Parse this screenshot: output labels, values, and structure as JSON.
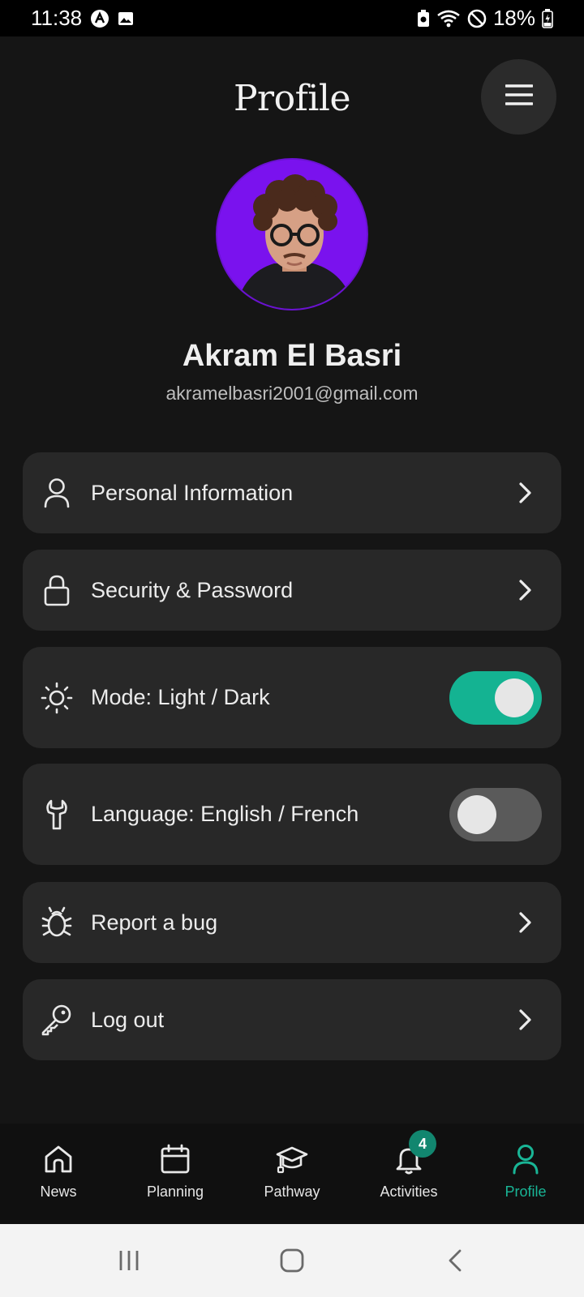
{
  "status_bar": {
    "time": "11:38",
    "battery": "18%",
    "icons": [
      "a-app-icon",
      "image-icon",
      "battery-saver-icon",
      "wifi-icon",
      "do-not-disturb-icon",
      "battery-charging-icon"
    ]
  },
  "header": {
    "title": "Profile",
    "menu_icon": "hamburger-icon"
  },
  "user": {
    "name": "Akram El Basri",
    "email": "akramelbasri2001@gmail.com"
  },
  "menu": {
    "items": [
      {
        "label": "Personal Information",
        "icon": "user-icon",
        "control": "chevron"
      },
      {
        "label": "Security & Password",
        "icon": "lock-icon",
        "control": "chevron"
      },
      {
        "label": "Mode: Light / Dark",
        "icon": "sun-icon",
        "control": "toggle",
        "toggle_on": true
      },
      {
        "label": "Language: English / French",
        "icon": "wrench-icon",
        "control": "toggle",
        "toggle_on": false
      },
      {
        "label": "Report a bug",
        "icon": "bug-icon",
        "control": "chevron"
      },
      {
        "label": "Log out",
        "icon": "key-icon",
        "control": "chevron"
      }
    ]
  },
  "bottom_nav": {
    "items": [
      {
        "label": "News",
        "icon": "home-icon"
      },
      {
        "label": "Planning",
        "icon": "calendar-icon"
      },
      {
        "label": "Pathway",
        "icon": "graduation-cap-icon"
      },
      {
        "label": "Activities",
        "icon": "bell-icon",
        "badge": "4"
      },
      {
        "label": "Profile",
        "icon": "user-icon",
        "active": true
      }
    ]
  },
  "colors": {
    "background": "#151515",
    "card": "#282828",
    "accent": "#14b392",
    "avatar_bg": "#7a12ee"
  }
}
